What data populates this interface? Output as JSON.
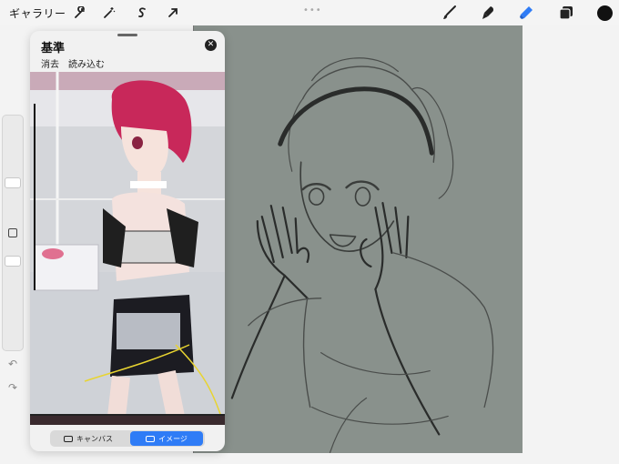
{
  "toolbar": {
    "gallery_label": "ギャラリー",
    "left_icons": [
      "wrench-icon",
      "magic-wand-icon",
      "selection-s-icon",
      "transform-arrow-icon"
    ],
    "right_icons": [
      "brush-icon",
      "smudge-icon",
      "eraser-icon",
      "layers-icon",
      "color-swatch-icon"
    ],
    "accent_color": "#2f7cf6",
    "active_color": "#111111"
  },
  "reference_panel": {
    "title": "基準",
    "actions": [
      "消去",
      "読み込む"
    ],
    "mode_buttons": [
      {
        "label": "キャンバス",
        "active": false
      },
      {
        "label": "イメージ",
        "active": true
      }
    ]
  },
  "canvas": {
    "background": "#89918c"
  }
}
